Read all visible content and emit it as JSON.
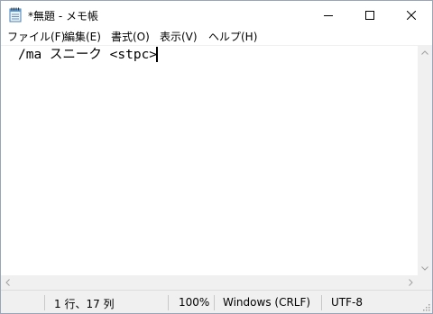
{
  "window": {
    "title": "*無題 - メモ帳",
    "icon": "notepad-icon",
    "controls": {
      "minimize": "minimize-icon",
      "maximize": "maximize-icon",
      "close": "close-icon"
    }
  },
  "menu": {
    "items": [
      {
        "label": "ファイル(F)"
      },
      {
        "label": "編集(E)"
      },
      {
        "label": "書式(O)"
      },
      {
        "label": "表示(V)"
      },
      {
        "label": "ヘルプ(H)"
      }
    ]
  },
  "editor": {
    "text": "/ma スニーク <stpc>"
  },
  "status": {
    "position": "1 行、17 列",
    "zoom": "100%",
    "line_ending": "Windows (CRLF)",
    "encoding": "UTF-8"
  },
  "colors": {
    "frame": "#9aa6b8",
    "chrome": "#f0f0f0",
    "separator": "#c8c8c8"
  }
}
